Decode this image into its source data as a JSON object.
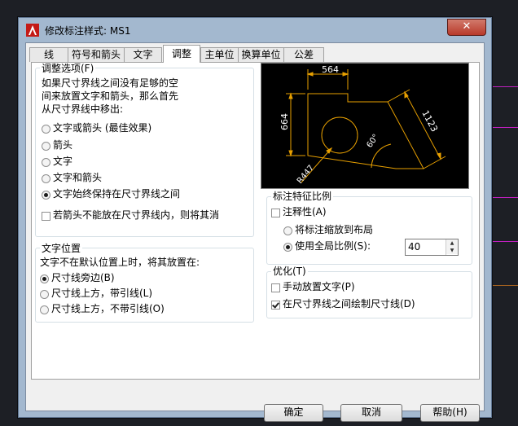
{
  "window": {
    "title": "修改标注样式: MS1",
    "close_glyph": "✕"
  },
  "tabs": [
    {
      "label": "线"
    },
    {
      "label": "符号和箭头"
    },
    {
      "label": "文字"
    },
    {
      "label": "调整",
      "active": true
    },
    {
      "label": "主单位"
    },
    {
      "label": "换算单位"
    },
    {
      "label": "公差"
    }
  ],
  "fit_options": {
    "title": "调整选项(F)",
    "description": [
      "如果尺寸界线之间没有足够的空",
      "间来放置文字和箭头，那么首先",
      "从尺寸界线中移出:"
    ],
    "radios": [
      {
        "label": "文字或箭头 (最佳效果)",
        "selected": false
      },
      {
        "label": "箭头",
        "selected": false
      },
      {
        "label": "文字",
        "selected": false
      },
      {
        "label": "文字和箭头",
        "selected": false
      },
      {
        "label": "文字始终保持在尺寸界线之间",
        "selected": true
      }
    ],
    "checkbox": {
      "label": "若箭头不能放在尺寸界线内，则将其消",
      "checked": false
    }
  },
  "text_placement": {
    "title": "文字位置",
    "description": "文字不在默认位置上时，将其放置在:",
    "radios": [
      {
        "label": "尺寸线旁边(B)",
        "selected": true
      },
      {
        "label": "尺寸线上方，带引线(L)",
        "selected": false
      },
      {
        "label": "尺寸线上方，不带引线(O)",
        "selected": false
      }
    ]
  },
  "preview": {
    "labels": {
      "top": "564",
      "left": "664",
      "slant": "1123",
      "angle": "60°",
      "radius": "R447"
    }
  },
  "scale": {
    "title": "标注特征比例",
    "annotative": {
      "label": "注释性(A)",
      "checked": false
    },
    "radios": [
      {
        "label": "将标注缩放到布局",
        "selected": false
      },
      {
        "label": "使用全局比例(S):",
        "selected": true
      }
    ],
    "global_scale_value": "40"
  },
  "fine_tuning": {
    "title": "优化(T)",
    "checkboxes": [
      {
        "label": "手动放置文字(P)",
        "checked": false
      },
      {
        "label": "在尺寸界线之间绘制尺寸线(D)",
        "checked": true
      }
    ]
  },
  "buttons": {
    "ok": "确定",
    "cancel": "取消",
    "help": "帮助(H)"
  },
  "colors": {
    "preview_line": "#e8a000",
    "preview_text": "#ffffff",
    "background_lines": "#c020c0"
  }
}
